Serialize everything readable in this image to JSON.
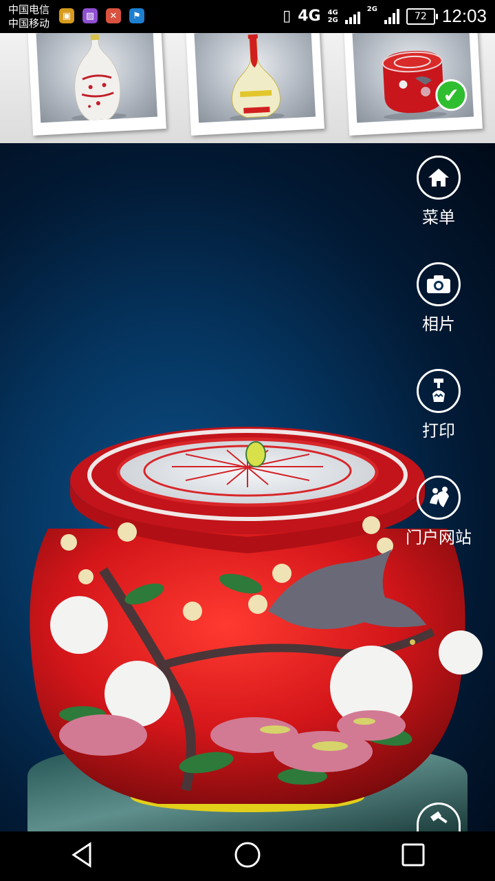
{
  "status_bar": {
    "carrier_1": "中国电信",
    "carrier_2": "中国移动",
    "network": "4G",
    "network_small_top": "4G",
    "network_small_bottom": "2G",
    "network_second": "2G",
    "battery": "72",
    "time": "12:03",
    "notification_icons": [
      "sim-toolkit-icon",
      "gallery-icon",
      "tools-icon",
      "flag-app-icon"
    ]
  },
  "thumbnails": [
    {
      "name": "white-red-vase",
      "selected": false
    },
    {
      "name": "gold-garlic-vase",
      "selected": false
    },
    {
      "name": "red-jar",
      "selected": true
    }
  ],
  "side_menu": {
    "menu": "菜单",
    "photos": "相片",
    "print": "打印",
    "portal": "门户网站"
  },
  "nav_bar": {
    "back": "back-icon",
    "home": "home-icon",
    "recents": "recents-icon"
  },
  "colors": {
    "jar_red": "#d41a1a",
    "check_green": "#2fbe2f",
    "scene_blue": "#053560"
  }
}
